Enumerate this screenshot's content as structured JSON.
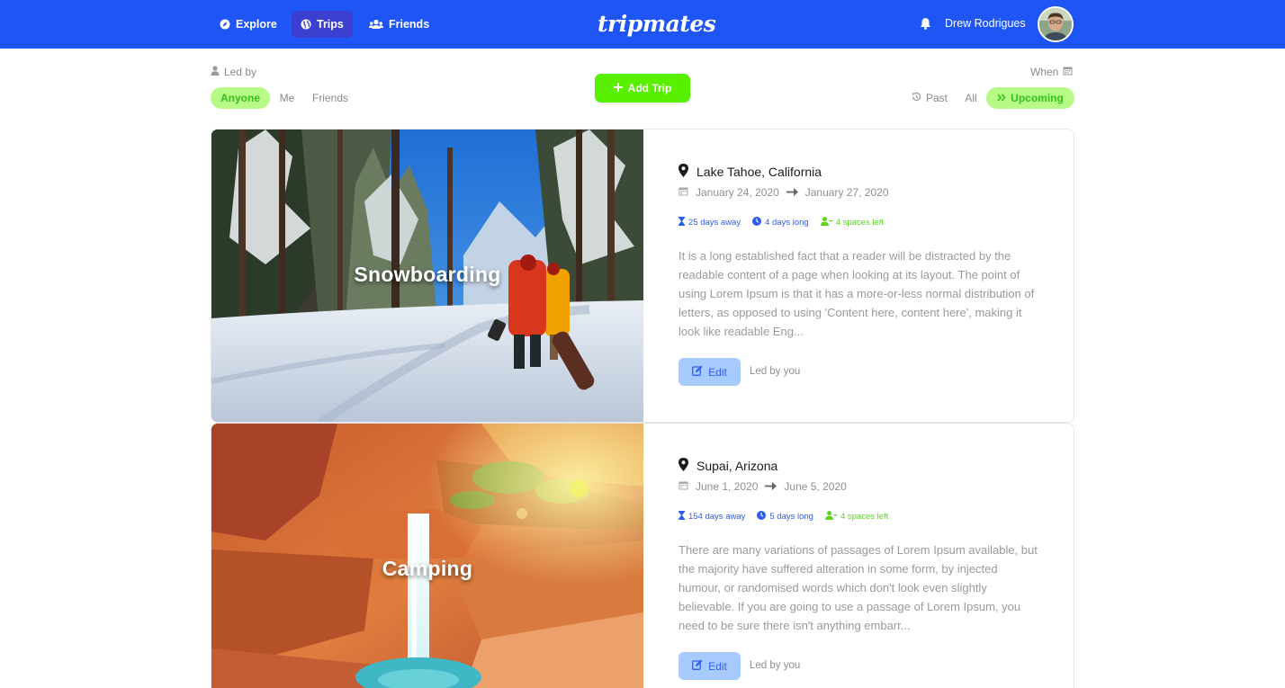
{
  "nav": {
    "items": [
      {
        "label": "Explore",
        "icon": "compass-icon",
        "active": false
      },
      {
        "label": "Trips",
        "icon": "globe-icon",
        "active": true
      },
      {
        "label": "Friends",
        "icon": "users-icon",
        "active": false
      }
    ],
    "logo": "tripmates",
    "user_name": "Drew Rodrigues",
    "bell_icon": "bell-icon",
    "brand_color": "#1f55f5"
  },
  "filters": {
    "led_by_label": "Led by",
    "led_by_options": [
      "Anyone",
      "Me",
      "Friends"
    ],
    "led_by_selected": "Anyone",
    "add_trip_label": "Add Trip",
    "when_label": "When",
    "when_options": [
      "Past",
      "All",
      "Upcoming"
    ],
    "when_selected": "Upcoming",
    "accent_green": "#59f000"
  },
  "trips": [
    {
      "activity": "Snowboarding",
      "location": "Lake Tahoe, California",
      "start_date": "January 24, 2020",
      "end_date": "January 27, 2020",
      "days_away": "25 days away",
      "duration": "4 days long",
      "spaces": "4 spaces left",
      "description": "It is a long established fact that a reader will be distracted by the readable content of a page when looking at its layout. The point of using Lorem Ipsum is that it has a more-or-less normal distribution of letters, as opposed to using 'Content here, content here', making it look like readable Eng...",
      "edit_label": "Edit",
      "led_by": "Led by you"
    },
    {
      "activity": "Camping",
      "location": "Supai, Arizona",
      "start_date": "June 1, 2020",
      "end_date": "June 5, 2020",
      "days_away": "154 days away",
      "duration": "5 days long",
      "spaces": "4 spaces left",
      "description": "There are many variations of passages of Lorem Ipsum available, but the majority have suffered alteration in some form, by injected humour, or randomised words which don't look even slightly believable. If you are going to use a passage of Lorem Ipsum, you need to be sure there isn't anything embarr...",
      "edit_label": "Edit",
      "led_by": "Led by you"
    }
  ]
}
